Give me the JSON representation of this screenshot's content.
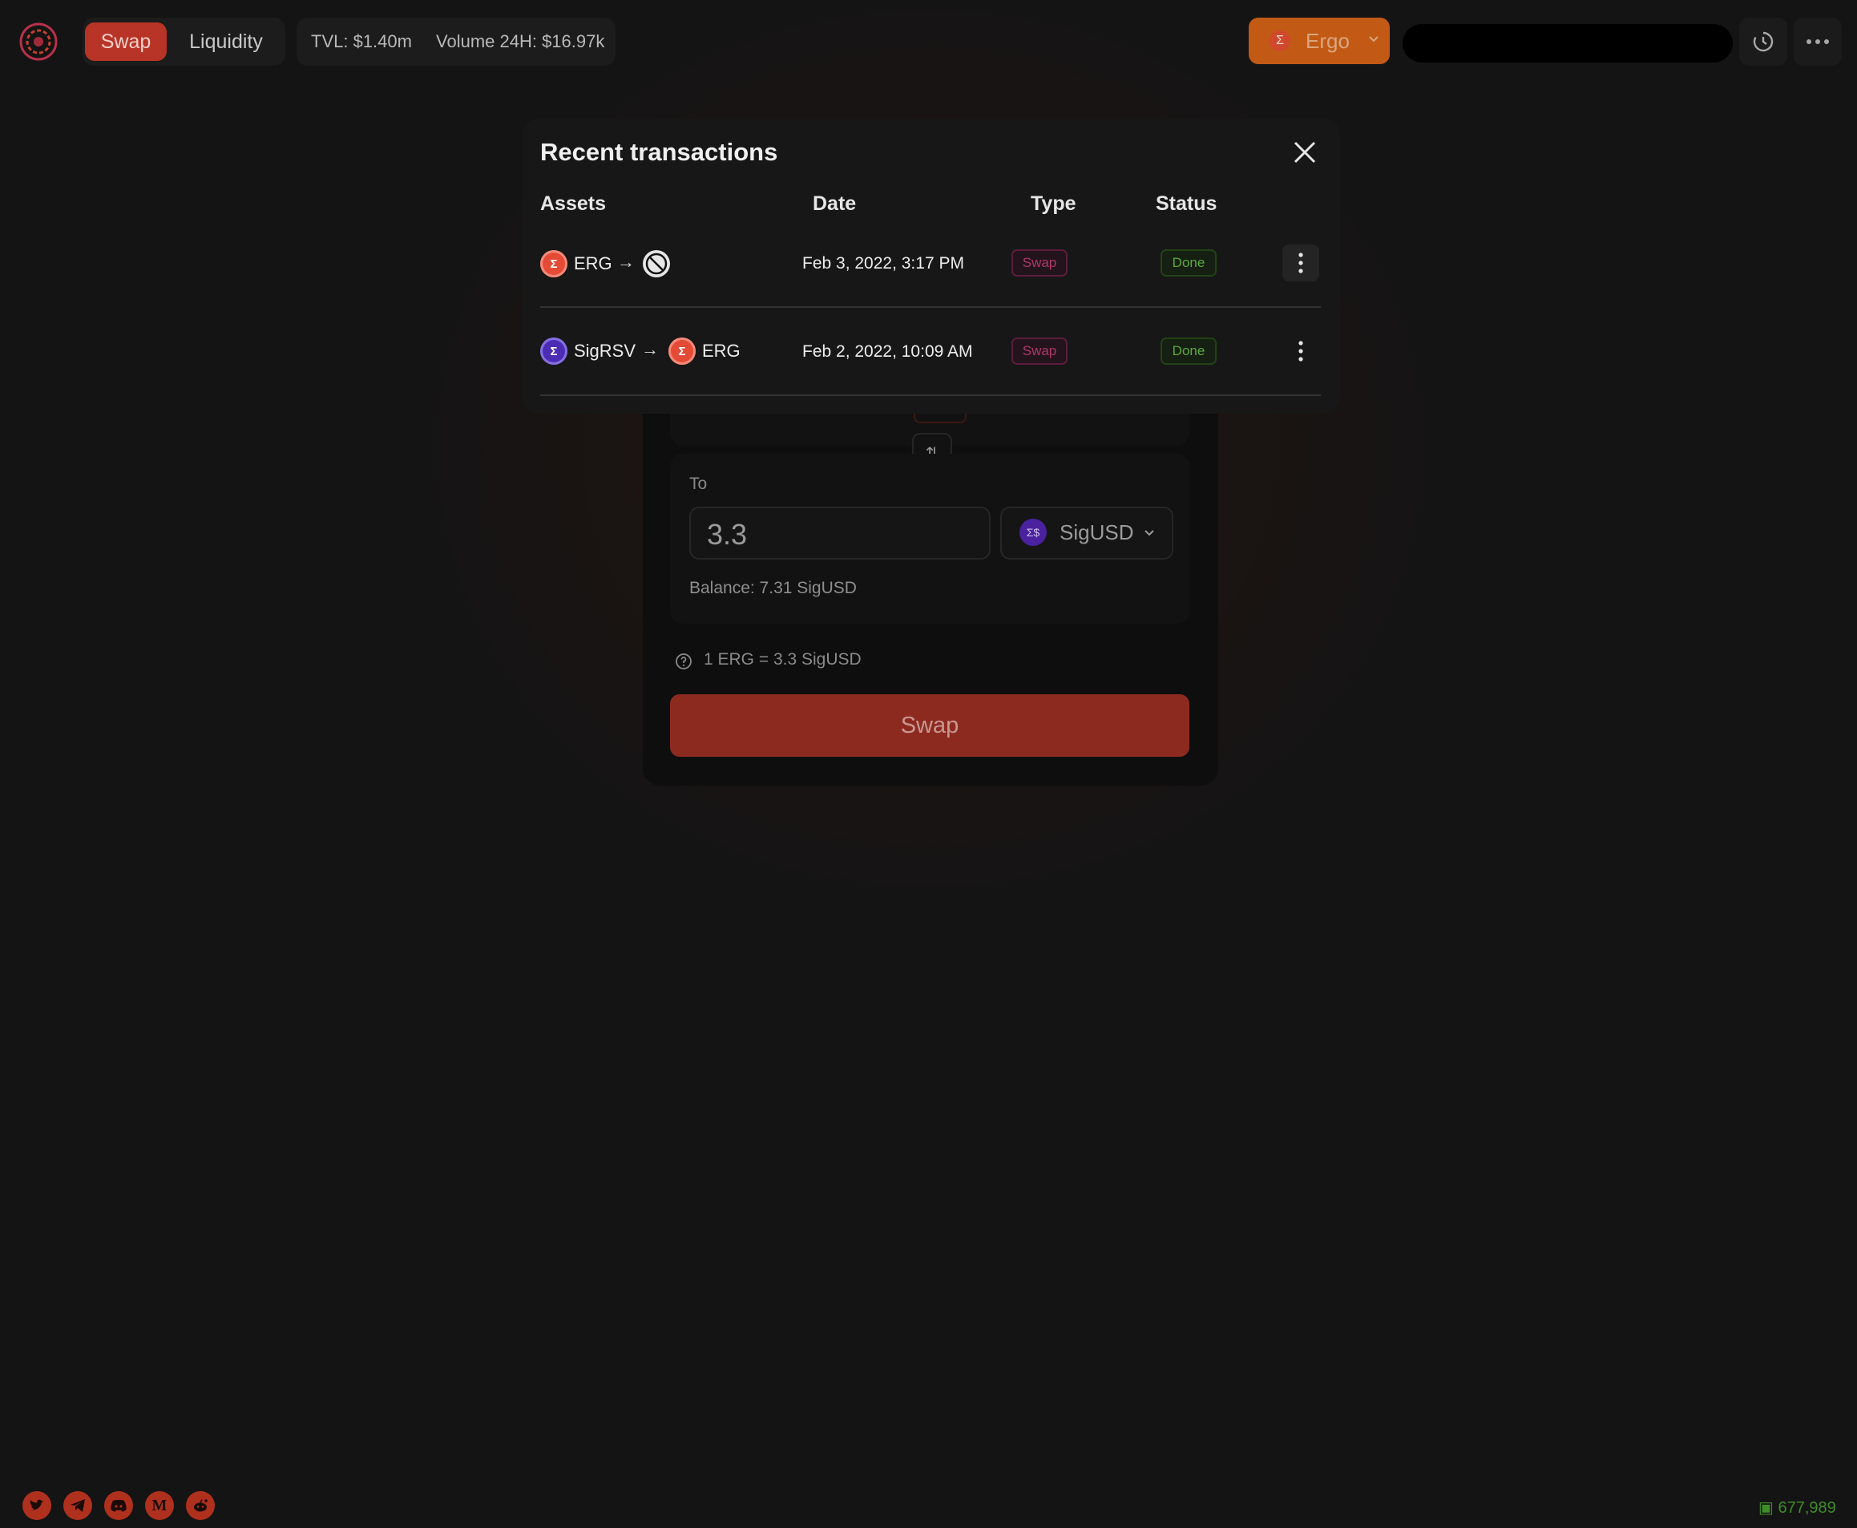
{
  "header": {
    "nav_swap": "Swap",
    "nav_liquidity": "Liquidity",
    "tvl": "TVL: $1.40m",
    "volume": "Volume 24H: $16.97k",
    "network_label": "Ergo",
    "network_icon": "Σ",
    "history_icon": "history-icon",
    "more_icon": "more-horizontal-icon"
  },
  "swap": {
    "to_label": "To",
    "to_value": "3.3",
    "to_token": "SigUSD",
    "to_token_icon": "Σ$",
    "to_balance": "Balance: 7.31 SigUSD",
    "rate": "1 ERG = 3.3 SigUSD",
    "swap_button": "Swap",
    "switch_icon": "⇅"
  },
  "modal": {
    "title": "Recent transactions",
    "columns": {
      "assets": "Assets",
      "date": "Date",
      "type": "Type",
      "status": "Status"
    },
    "rows": [
      {
        "from_asset": "ERG",
        "from_icon": "Σ",
        "to_asset": "",
        "date": "Feb 3, 2022, 3:17 PM",
        "type": "Swap",
        "status": "Done"
      },
      {
        "from_asset": "SigRSV",
        "from_icon": "Σ",
        "to_asset": "ERG",
        "to_icon": "Σ",
        "date": "Feb 2, 2022, 10:09 AM",
        "type": "Swap",
        "status": "Done"
      }
    ],
    "arrow": "→"
  },
  "footer": {
    "socials": [
      "twitter-icon",
      "telegram-icon",
      "discord-icon",
      "medium-icon",
      "reddit-icon"
    ],
    "medium_letter": "M",
    "block_height": "677,989"
  },
  "colors": {
    "accent": "#b83426",
    "network": "#c25a16",
    "status_done": "#5fa83b",
    "type_swap": "#b0386c"
  }
}
